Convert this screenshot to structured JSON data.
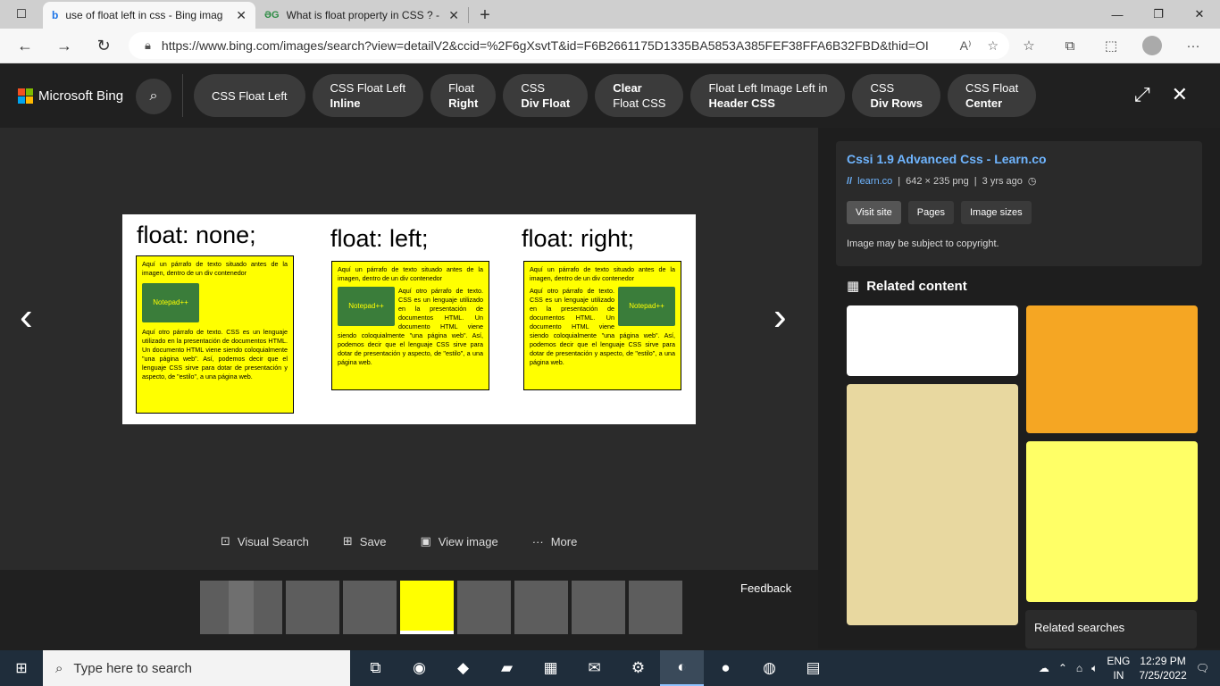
{
  "browser": {
    "tabs": [
      {
        "title": "use of float left in css - Bing imag",
        "icon": "bing-icon",
        "active": true
      },
      {
        "title": "What is float property in CSS ? -",
        "icon": "gfg-icon",
        "active": false
      }
    ],
    "new_tab": "+",
    "url": "https://www.bing.com/images/search?view=detailV2&ccid=%2F6gXsvtT&id=F6B2661175D1335BA5853A385FEF38FFA6B32FBD&thid=OI..."
  },
  "bing": {
    "brand": "Microsoft Bing",
    "chips": [
      {
        "line1": "CSS Float Left",
        "line2": ""
      },
      {
        "line1": "CSS Float Left",
        "line2": "Inline"
      },
      {
        "line1": "Float",
        "line2": "Right"
      },
      {
        "line1": "CSS",
        "line2": "Div Float"
      },
      {
        "line1": "Clear",
        "line2": "Float CSS"
      },
      {
        "line1": "Float Left Image Left in",
        "line2": "Header CSS"
      },
      {
        "line1": "CSS",
        "line2": "Div Rows"
      },
      {
        "line1": "CSS Float",
        "line2": "Center"
      }
    ]
  },
  "image": {
    "titles": [
      "float: none;",
      "float: left;",
      "float: right;"
    ],
    "intro": "Aquí un párrafo de texto situado antes de la imagen, dentro de un div contenedor",
    "wrap_text": "Aquí otro párrafo de texto. CSS es un lenguaje utilizado en la presentación de documentos HTML. Un documento HTML viene siendo coloquialmente \"una página web\". Así, podemos decir que el lenguaje CSS sirve para dotar de presentación y aspecto, de \"estilo\", a una página web.",
    "notepad_label": "Notepad++"
  },
  "actions": {
    "visual_search": "Visual Search",
    "save": "Save",
    "view_image": "View image",
    "more": "More"
  },
  "feedback": "Feedback",
  "side": {
    "title": "Cssi 1.9 Advanced Css - Learn.co",
    "source": "learn.co",
    "dims": "642 × 235 png",
    "age": "3 yrs ago",
    "buttons": [
      "Visit site",
      "Pages",
      "Image sizes"
    ],
    "copyright": "Image may be subject to copyright.",
    "related_content": "Related content",
    "related_searches": "Related searches"
  },
  "taskbar": {
    "search_placeholder": "Type here to search",
    "lang1": "ENG",
    "lang2": "IN",
    "time": "12:29 PM",
    "date": "7/25/2022"
  }
}
